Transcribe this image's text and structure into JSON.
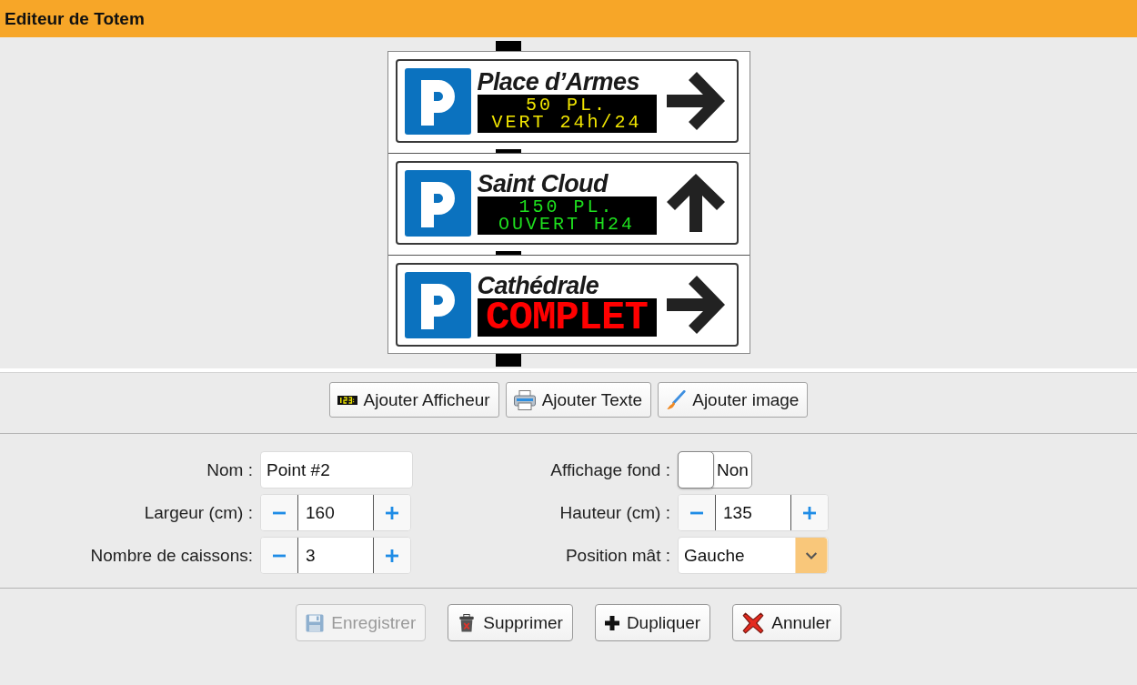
{
  "header": {
    "title": "Editeur de Totem"
  },
  "totem": {
    "panels": [
      {
        "name": "Place d’Armes",
        "display": {
          "lines": [
            "50 PL.",
            "VERT 24h/24"
          ],
          "color": "#f0e400"
        },
        "kind": "right"
      },
      {
        "name": "Saint Cloud",
        "display": {
          "lines": [
            "150 PL.",
            "OUVERT H24"
          ],
          "color": "#1ee01e"
        },
        "kind": "up"
      },
      {
        "name": "Cathédrale",
        "display": {
          "lines": [
            "COMPLET"
          ],
          "color": "#ff0000"
        },
        "kind": "right"
      }
    ]
  },
  "toolbar": {
    "buttons": [
      {
        "label": "Ajouter Afficheur"
      },
      {
        "label": "Ajouter Texte"
      },
      {
        "label": "Ajouter image"
      }
    ]
  },
  "form": {
    "fields": [
      {
        "kind": "text",
        "label": "Nom :",
        "value": "Point #2"
      },
      {
        "kind": "toggle",
        "label": "Affichage fond :",
        "on": false,
        "state_text": "Non"
      },
      {
        "kind": "stepper",
        "label": "Largeur (cm) :",
        "value": "160"
      },
      {
        "kind": "stepper",
        "label": "Hauteur (cm) :",
        "value": "135"
      },
      {
        "kind": "stepper",
        "label": "Nombre de caissons:",
        "value": "3"
      },
      {
        "kind": "select",
        "label": "Position mât :",
        "value": "Gauche"
      }
    ]
  },
  "actions": [
    {
      "label": "Enregistrer",
      "disabled": true
    },
    {
      "label": "Supprimer",
      "disabled": false
    },
    {
      "label": "Dupliquer",
      "disabled": false
    },
    {
      "label": "Annuler",
      "disabled": false
    }
  ]
}
